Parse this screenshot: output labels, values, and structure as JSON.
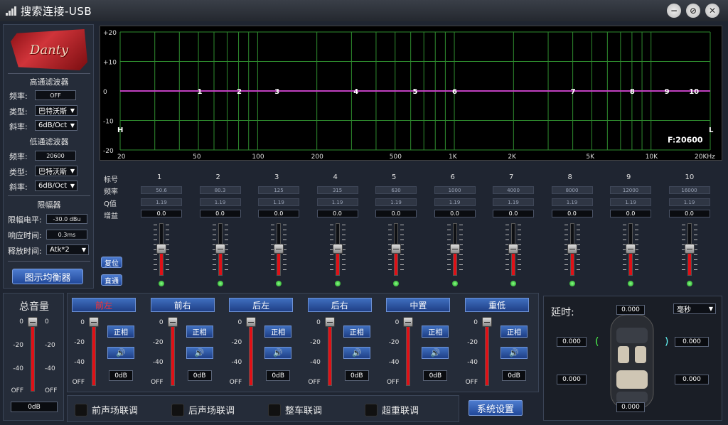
{
  "window": {
    "title": "搜索连接-USB",
    "minimize": "−",
    "restore": "⊘",
    "close": "✕"
  },
  "sidebar": {
    "logo": "Danty",
    "hpf": {
      "title": "高通滤波器",
      "freq_label": "频率:",
      "freq": "OFF",
      "type_label": "类型:",
      "type": "巴特沃斯",
      "slope_label": "斜率:",
      "slope": "6dB/Oct"
    },
    "lpf": {
      "title": "低通滤波器",
      "freq_label": "频率:",
      "freq": "20600",
      "type_label": "类型:",
      "type": "巴特沃斯",
      "slope_label": "斜率:",
      "slope": "6dB/Oct"
    },
    "limiter": {
      "title": "限幅器",
      "level_label": "限幅电平:",
      "level": "-30.0 dBu",
      "response_label": "响应时间:",
      "response": "0.3ms",
      "release_label": "释放时间:",
      "release": "Atk*2"
    },
    "eq_button": "图示均衡器"
  },
  "chart": {
    "y_ticks": [
      "+20",
      "+10",
      "0",
      "-10",
      "-20"
    ],
    "x_ticks": [
      "20",
      "50",
      "100",
      "200",
      "500",
      "1K",
      "2K",
      "5K",
      "10K",
      "20KHz"
    ],
    "h_marker": "H",
    "l_marker": "L",
    "freq_readout": "F:20600",
    "points": [
      "1",
      "2",
      "3",
      "4",
      "5",
      "6",
      "7",
      "8",
      "9",
      "10"
    ]
  },
  "chart_data": {
    "type": "line",
    "title": "",
    "xlabel": "",
    "ylabel": "",
    "ylim": [
      -20,
      20
    ],
    "xlim": [
      20,
      20000
    ],
    "x_scale": "log",
    "series": [
      {
        "values": [
          {
            "x": 50.6,
            "y": 0
          },
          {
            "x": 80.3,
            "y": 0
          },
          {
            "x": 125,
            "y": 0
          },
          {
            "x": 315,
            "y": 0
          },
          {
            "x": 630,
            "y": 0
          },
          {
            "x": 1000,
            "y": 0
          },
          {
            "x": 4000,
            "y": 0
          },
          {
            "x": 8000,
            "y": 0
          },
          {
            "x": 12000,
            "y": 0
          },
          {
            "x": 16000,
            "y": 0
          }
        ]
      }
    ]
  },
  "eq": {
    "row_labels": [
      "标号",
      "频率",
      "Q值",
      "增益"
    ],
    "bands": [
      {
        "id": "1",
        "freq": "50.6",
        "q": "1.19",
        "gain": "0.0"
      },
      {
        "id": "2",
        "freq": "80.3",
        "q": "1.19",
        "gain": "0.0"
      },
      {
        "id": "3",
        "freq": "125",
        "q": "1.19",
        "gain": "0.0"
      },
      {
        "id": "4",
        "freq": "315",
        "q": "1.19",
        "gain": "0.0"
      },
      {
        "id": "5",
        "freq": "630",
        "q": "1.19",
        "gain": "0.0"
      },
      {
        "id": "6",
        "freq": "1000",
        "q": "1.19",
        "gain": "0.0"
      },
      {
        "id": "7",
        "freq": "4000",
        "q": "1.19",
        "gain": "0.0"
      },
      {
        "id": "8",
        "freq": "8000",
        "q": "1.19",
        "gain": "0.0"
      },
      {
        "id": "9",
        "freq": "12000",
        "q": "1.19",
        "gain": "0.0"
      },
      {
        "id": "10",
        "freq": "16000",
        "q": "1.19",
        "gain": "0.0"
      }
    ],
    "reset": "复位",
    "bypass": "直通"
  },
  "master": {
    "title": "总音量",
    "scale": [
      "0",
      "-20",
      "-40",
      "OFF"
    ],
    "value": "0dB"
  },
  "channels": {
    "items": [
      {
        "name": "前左",
        "active": true,
        "phase": "正相",
        "value": "0dB"
      },
      {
        "name": "前右",
        "active": false,
        "phase": "正相",
        "value": "0dB"
      },
      {
        "name": "后左",
        "active": false,
        "phase": "正相",
        "value": "0dB"
      },
      {
        "name": "后右",
        "active": false,
        "phase": "正相",
        "value": "0dB"
      },
      {
        "name": "中置",
        "active": false,
        "phase": "正相",
        "value": "0dB"
      },
      {
        "name": "重低",
        "active": false,
        "phase": "正相",
        "value": "0dB"
      }
    ],
    "scale": [
      "0",
      "-20",
      "-40",
      "OFF"
    ]
  },
  "links": {
    "front": "前声场联调",
    "rear": "后声场联调",
    "whole": "整车联调",
    "sub": "超重联调"
  },
  "system_button": "系统设置",
  "delay": {
    "title": "延时:",
    "unit": "毫秒",
    "top": "0.000",
    "fl": "0.000",
    "fr": "0.000",
    "rl": "0.000",
    "rr": "0.000",
    "bottom": "0.000"
  },
  "colors": {
    "accent": "#2f5fb8",
    "fader_red": "#e01016",
    "curve": "#c040c0",
    "grid": "#2e8b2e"
  }
}
